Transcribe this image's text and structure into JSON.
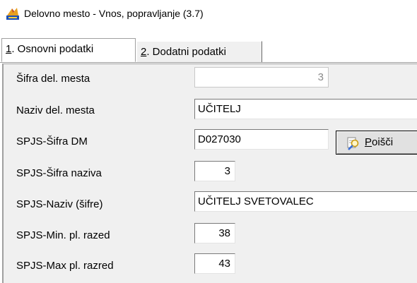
{
  "window": {
    "title": "Delovno mesto - Vnos, popravljanje  (3.7)",
    "icon": "app-icon"
  },
  "tabs": [
    {
      "number": "1",
      "label": ". Osnovni podatki",
      "active": true
    },
    {
      "number": "2",
      "label": ". Dodatni podatki",
      "active": false
    }
  ],
  "form": {
    "sifra_label": "Šifra del. mesta",
    "sifra_value": "3",
    "naziv_label": "Naziv del. mesta",
    "naziv_value": "UČITELJ",
    "spjs_sifra_dm_label": "SPJS-Šifra DM",
    "spjs_sifra_dm_value": "D027030",
    "spjs_sifra_naziva_label": "SPJS-Šifra naziva",
    "spjs_sifra_naziva_value": "3",
    "spjs_naziv_label": "SPJS-Naziv (šifre)",
    "spjs_naziv_value": "UČITELJ SVETOVALEC",
    "spjs_min_label": "SPJS-Min. pl. razed",
    "spjs_min_value": "38",
    "spjs_max_label": "SPJS-Max pl. razred",
    "spjs_max_value": "43"
  },
  "search_button": {
    "mnemonic": "P",
    "label_rest": "oišči",
    "icon": "search-icon"
  }
}
